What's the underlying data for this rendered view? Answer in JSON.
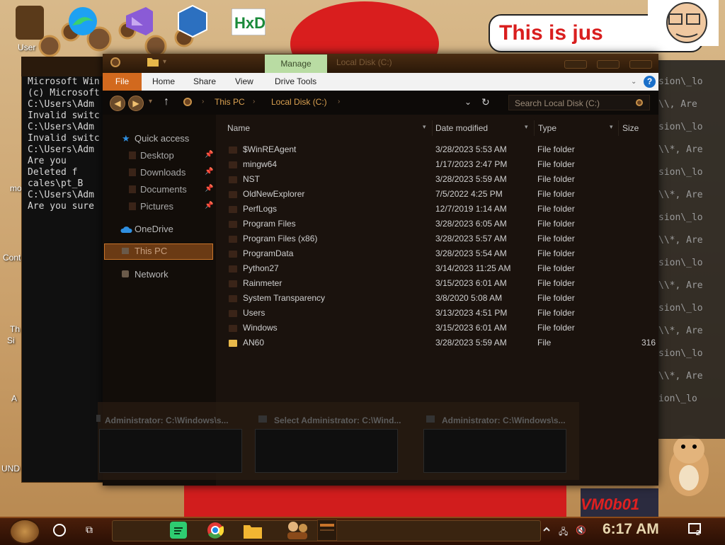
{
  "desktop": {
    "banner_text": "This is jus",
    "vm_text": "VM0b01",
    "icons": [
      {
        "label": "User"
      },
      {
        "label": "mo"
      },
      {
        "label": "Cont"
      },
      {
        "label": "Th"
      },
      {
        "label": "Si"
      },
      {
        "label": "A"
      },
      {
        "label": "UND"
      }
    ]
  },
  "console": {
    "lines": [
      "Microsoft Win",
      "(c) Microsoft",
      "",
      "C:\\Users\\Adm",
      "Invalid switc",
      "",
      "C:\\Users\\Adm",
      "Invalid switc",
      "",
      "C:\\Users\\Adm",
      "",
      "",
      "",
      "",
      "",
      "",
      "",
      "",
      "",
      "",
      "",
      "",
      "",
      "",
      "",
      "",
      "",
      "",
      "",
      "",
      "Are you",
      "Deleted f",
      "cales\\pt_B",
      "C:\\Users\\Adm",
      "Are you sure"
    ],
    "right_lines": [
      "sion\\_lo",
      "",
      "\\\\, Are",
      "sion\\_lo",
      "\\\\*, Are",
      "sion\\_lo",
      "\\\\*, Are",
      "sion\\_lo",
      "\\\\*, Are",
      "sion\\_lo",
      "\\\\*, Are",
      "sion\\_lo",
      "\\\\*, Are",
      "sion\\_lo",
      "\\\\*, Are",
      "ion\\_lo"
    ]
  },
  "explorer": {
    "title": "Local Disk (C:)",
    "manage_label": "Manage",
    "ribbon_tabs": {
      "file": "File",
      "home": "Home",
      "share": "Share",
      "view": "View",
      "drive_tools": "Drive Tools"
    },
    "help": "?",
    "breadcrumb": [
      "This PC",
      "Local Disk (C:)"
    ],
    "search_placeholder": "Search Local Disk (C:)",
    "nav": {
      "quick_access": "Quick access",
      "desktop": "Desktop",
      "downloads": "Downloads",
      "documents": "Documents",
      "pictures": "Pictures",
      "onedrive": "OneDrive",
      "this_pc": "This PC",
      "network": "Network"
    },
    "columns": [
      "Name",
      "Date modified",
      "Type",
      "Size"
    ],
    "rows": [
      {
        "name": "$WinREAgent",
        "date": "3/28/2023 5:53 AM",
        "type": "File folder",
        "size": ""
      },
      {
        "name": "mingw64",
        "date": "1/17/2023 2:47 PM",
        "type": "File folder",
        "size": ""
      },
      {
        "name": "NST",
        "date": "3/28/2023 5:59 AM",
        "type": "File folder",
        "size": ""
      },
      {
        "name": "OldNewExplorer",
        "date": "7/5/2022 4:25 PM",
        "type": "File folder",
        "size": ""
      },
      {
        "name": "PerfLogs",
        "date": "12/7/2019 1:14 AM",
        "type": "File folder",
        "size": ""
      },
      {
        "name": "Program Files",
        "date": "3/28/2023 6:05 AM",
        "type": "File folder",
        "size": ""
      },
      {
        "name": "Program Files (x86)",
        "date": "3/28/2023 5:57 AM",
        "type": "File folder",
        "size": ""
      },
      {
        "name": "ProgramData",
        "date": "3/28/2023 5:54 AM",
        "type": "File folder",
        "size": ""
      },
      {
        "name": "Python27",
        "date": "3/14/2023 11:25 AM",
        "type": "File folder",
        "size": ""
      },
      {
        "name": "Rainmeter",
        "date": "3/15/2023 6:01 AM",
        "type": "File folder",
        "size": ""
      },
      {
        "name": "System Transparency",
        "date": "3/8/2020 5:08 AM",
        "type": "File folder",
        "size": ""
      },
      {
        "name": "Users",
        "date": "3/13/2023 4:51 PM",
        "type": "File folder",
        "size": ""
      },
      {
        "name": "Windows",
        "date": "3/15/2023 6:01 AM",
        "type": "File folder",
        "size": ""
      },
      {
        "name": "AN60",
        "date": "3/28/2023 5:59 AM",
        "type": "File",
        "size": "316"
      }
    ]
  },
  "previews": [
    {
      "title": "Administrator: C:\\Windows\\s..."
    },
    {
      "title": "Select Administrator: C:\\Wind..."
    },
    {
      "title": "Administrator: C:\\Windows\\s..."
    }
  ],
  "taskbar": {
    "clock": "6:17 AM",
    "notifications": "2",
    "apps": [
      "spotify",
      "chrome",
      "file-explorer",
      "people",
      "terminal"
    ]
  },
  "colors": {
    "accent": "#d2691e",
    "manage_tab": "#b9dca3",
    "breadcrumb": "#d9a050",
    "selection": "#6a3a14"
  }
}
